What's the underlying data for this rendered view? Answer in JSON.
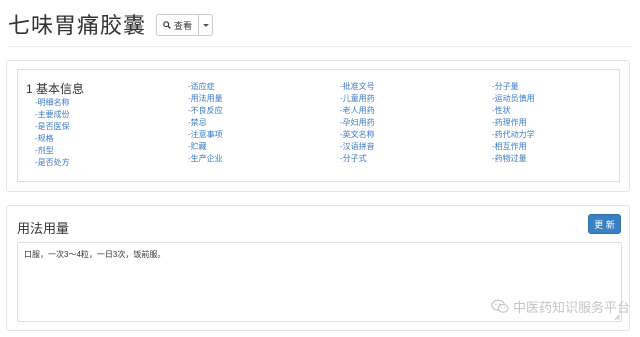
{
  "header": {
    "title": "七味胃痛胶囊",
    "view_button_label": "查看",
    "icons": {
      "view": "search-icon",
      "dropdown": "caret-down-icon"
    }
  },
  "toc": {
    "heading": "1 基本信息",
    "columns": [
      [
        "-明细名称",
        "-主要成份",
        "-是否医保",
        "-规格",
        "-剂型",
        "-是否处方"
      ],
      [
        "-适应症",
        "-用法用量",
        "-不良反应",
        "-禁忌",
        "-注意事项",
        "-贮藏",
        "-生产企业"
      ],
      [
        "-批准文号",
        "-儿童用药",
        "-老人用药",
        "-孕妇用药",
        "-英文名称",
        "-汉语拼音",
        "-分子式"
      ],
      [
        "-分子量",
        "-运动员慎用",
        "-性状",
        "-药理作用",
        "-药代动力学",
        "-相互作用",
        "-药物过量"
      ]
    ]
  },
  "section": {
    "title": "用法用量",
    "update_button_label": "更 新",
    "content": "口服，一次3～4粒，一日3次，饭前服。"
  },
  "watermark": {
    "text": "中医药知识服务平台",
    "icon": "wechat-icon"
  },
  "colors": {
    "link": "#3b7ac3",
    "primary_button": "#3a81c4",
    "border": "#dddddd"
  }
}
